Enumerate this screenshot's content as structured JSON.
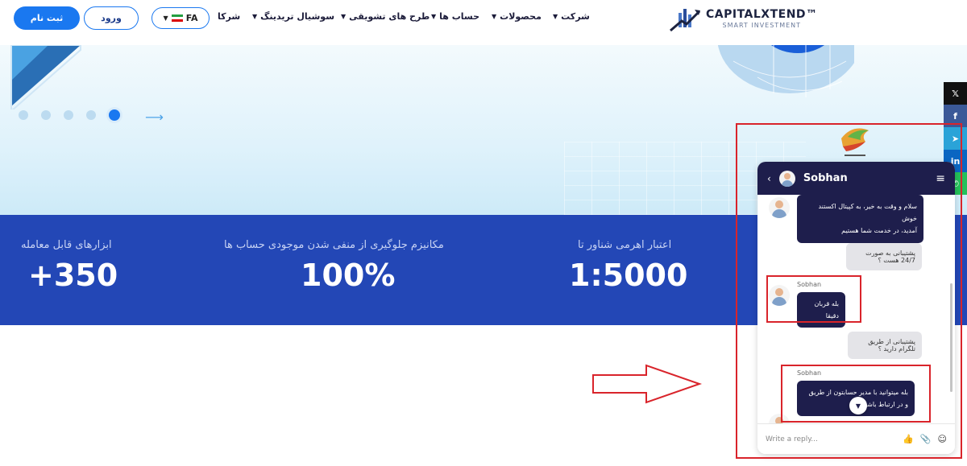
{
  "header": {
    "register_label": "ثبت نام",
    "login_label": "ورود",
    "lang_label": "FA",
    "nav": [
      {
        "label": "شرکا",
        "chevron": false
      },
      {
        "label": "سوشیال تریدینگ",
        "chevron": true
      },
      {
        "label": "طرح های تشویقی",
        "chevron": true
      },
      {
        "label": "حساب ها",
        "chevron": true
      },
      {
        "label": "محصولات",
        "chevron": true
      },
      {
        "label": "شرکت",
        "chevron": true
      }
    ],
    "logo_name": "CAPITALXTEND™",
    "logo_sub": "SMART INVESTMENT"
  },
  "hero": {
    "dots_count": 5,
    "active_dot": 5
  },
  "stats": [
    {
      "label": "ابزارهای قابل معامله",
      "value": "+350"
    },
    {
      "label": "مکانیزم جلوگیری از منفی شدن موجودی حساب ها",
      "value": "100%"
    },
    {
      "label": "اعتبار اهرمی شناور تا",
      "value": "1:5000"
    }
  ],
  "social": [
    "x-icon",
    "facebook-icon",
    "telegram-icon",
    "linkedin-icon"
  ],
  "chat": {
    "agent_name": "Sobhan",
    "messages": [
      {
        "from": "agent",
        "text_line1": "سلام و وقت به خیر، به کپیتال اکستند خوش",
        "text_line2": "آمدید، در خدمت شما هستیم"
      },
      {
        "from": "user",
        "text": "پشتیبانی به صورت 24/7 هست ؟"
      },
      {
        "from": "agent",
        "label": "Sobhan",
        "text": "بله قربان دقیقا"
      },
      {
        "from": "user",
        "text": "پشتیبانی از طریق تلگرام دارید ؟"
      },
      {
        "from": "agent",
        "label": "Sobhan",
        "text_line1": "بله میتوانید با مدیر حسابتون از طریق",
        "text_line2": "و در ارتباط باشید"
      }
    ],
    "reply_placeholder": "Write a reply..."
  },
  "colors": {
    "primary": "#1a78f0",
    "stats_bg": "#2347b6",
    "chat_dark": "#1e1e4c",
    "annotation_red": "#d9242b"
  }
}
